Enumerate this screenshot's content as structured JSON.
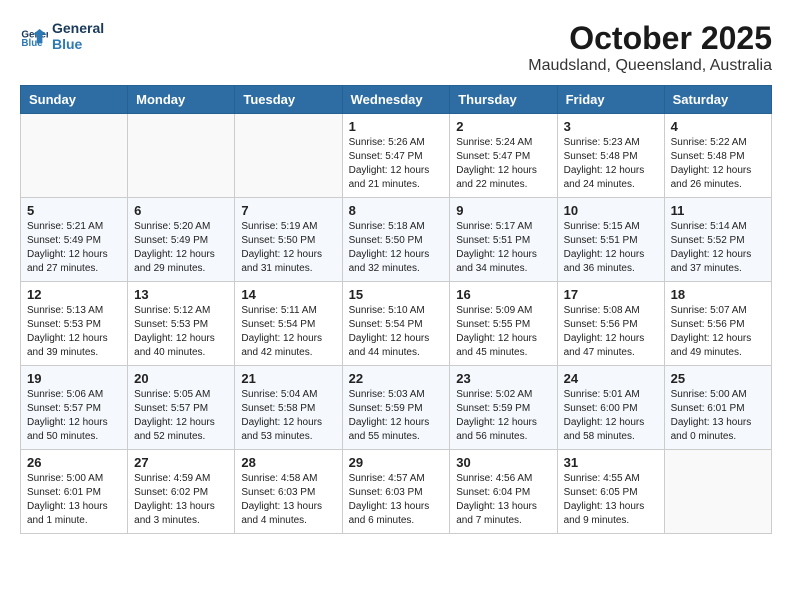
{
  "header": {
    "logo_line1": "General",
    "logo_line2": "Blue",
    "month": "October 2025",
    "location": "Maudsland, Queensland, Australia"
  },
  "weekdays": [
    "Sunday",
    "Monday",
    "Tuesday",
    "Wednesday",
    "Thursday",
    "Friday",
    "Saturday"
  ],
  "rows": [
    [
      {
        "day": "",
        "content": ""
      },
      {
        "day": "",
        "content": ""
      },
      {
        "day": "",
        "content": ""
      },
      {
        "day": "1",
        "content": "Sunrise: 5:26 AM\nSunset: 5:47 PM\nDaylight: 12 hours\nand 21 minutes."
      },
      {
        "day": "2",
        "content": "Sunrise: 5:24 AM\nSunset: 5:47 PM\nDaylight: 12 hours\nand 22 minutes."
      },
      {
        "day": "3",
        "content": "Sunrise: 5:23 AM\nSunset: 5:48 PM\nDaylight: 12 hours\nand 24 minutes."
      },
      {
        "day": "4",
        "content": "Sunrise: 5:22 AM\nSunset: 5:48 PM\nDaylight: 12 hours\nand 26 minutes."
      }
    ],
    [
      {
        "day": "5",
        "content": "Sunrise: 5:21 AM\nSunset: 5:49 PM\nDaylight: 12 hours\nand 27 minutes."
      },
      {
        "day": "6",
        "content": "Sunrise: 5:20 AM\nSunset: 5:49 PM\nDaylight: 12 hours\nand 29 minutes."
      },
      {
        "day": "7",
        "content": "Sunrise: 5:19 AM\nSunset: 5:50 PM\nDaylight: 12 hours\nand 31 minutes."
      },
      {
        "day": "8",
        "content": "Sunrise: 5:18 AM\nSunset: 5:50 PM\nDaylight: 12 hours\nand 32 minutes."
      },
      {
        "day": "9",
        "content": "Sunrise: 5:17 AM\nSunset: 5:51 PM\nDaylight: 12 hours\nand 34 minutes."
      },
      {
        "day": "10",
        "content": "Sunrise: 5:15 AM\nSunset: 5:51 PM\nDaylight: 12 hours\nand 36 minutes."
      },
      {
        "day": "11",
        "content": "Sunrise: 5:14 AM\nSunset: 5:52 PM\nDaylight: 12 hours\nand 37 minutes."
      }
    ],
    [
      {
        "day": "12",
        "content": "Sunrise: 5:13 AM\nSunset: 5:53 PM\nDaylight: 12 hours\nand 39 minutes."
      },
      {
        "day": "13",
        "content": "Sunrise: 5:12 AM\nSunset: 5:53 PM\nDaylight: 12 hours\nand 40 minutes."
      },
      {
        "day": "14",
        "content": "Sunrise: 5:11 AM\nSunset: 5:54 PM\nDaylight: 12 hours\nand 42 minutes."
      },
      {
        "day": "15",
        "content": "Sunrise: 5:10 AM\nSunset: 5:54 PM\nDaylight: 12 hours\nand 44 minutes."
      },
      {
        "day": "16",
        "content": "Sunrise: 5:09 AM\nSunset: 5:55 PM\nDaylight: 12 hours\nand 45 minutes."
      },
      {
        "day": "17",
        "content": "Sunrise: 5:08 AM\nSunset: 5:56 PM\nDaylight: 12 hours\nand 47 minutes."
      },
      {
        "day": "18",
        "content": "Sunrise: 5:07 AM\nSunset: 5:56 PM\nDaylight: 12 hours\nand 49 minutes."
      }
    ],
    [
      {
        "day": "19",
        "content": "Sunrise: 5:06 AM\nSunset: 5:57 PM\nDaylight: 12 hours\nand 50 minutes."
      },
      {
        "day": "20",
        "content": "Sunrise: 5:05 AM\nSunset: 5:57 PM\nDaylight: 12 hours\nand 52 minutes."
      },
      {
        "day": "21",
        "content": "Sunrise: 5:04 AM\nSunset: 5:58 PM\nDaylight: 12 hours\nand 53 minutes."
      },
      {
        "day": "22",
        "content": "Sunrise: 5:03 AM\nSunset: 5:59 PM\nDaylight: 12 hours\nand 55 minutes."
      },
      {
        "day": "23",
        "content": "Sunrise: 5:02 AM\nSunset: 5:59 PM\nDaylight: 12 hours\nand 56 minutes."
      },
      {
        "day": "24",
        "content": "Sunrise: 5:01 AM\nSunset: 6:00 PM\nDaylight: 12 hours\nand 58 minutes."
      },
      {
        "day": "25",
        "content": "Sunrise: 5:00 AM\nSunset: 6:01 PM\nDaylight: 13 hours\nand 0 minutes."
      }
    ],
    [
      {
        "day": "26",
        "content": "Sunrise: 5:00 AM\nSunset: 6:01 PM\nDaylight: 13 hours\nand 1 minute."
      },
      {
        "day": "27",
        "content": "Sunrise: 4:59 AM\nSunset: 6:02 PM\nDaylight: 13 hours\nand 3 minutes."
      },
      {
        "day": "28",
        "content": "Sunrise: 4:58 AM\nSunset: 6:03 PM\nDaylight: 13 hours\nand 4 minutes."
      },
      {
        "day": "29",
        "content": "Sunrise: 4:57 AM\nSunset: 6:03 PM\nDaylight: 13 hours\nand 6 minutes."
      },
      {
        "day": "30",
        "content": "Sunrise: 4:56 AM\nSunset: 6:04 PM\nDaylight: 13 hours\nand 7 minutes."
      },
      {
        "day": "31",
        "content": "Sunrise: 4:55 AM\nSunset: 6:05 PM\nDaylight: 13 hours\nand 9 minutes."
      },
      {
        "day": "",
        "content": ""
      }
    ]
  ]
}
